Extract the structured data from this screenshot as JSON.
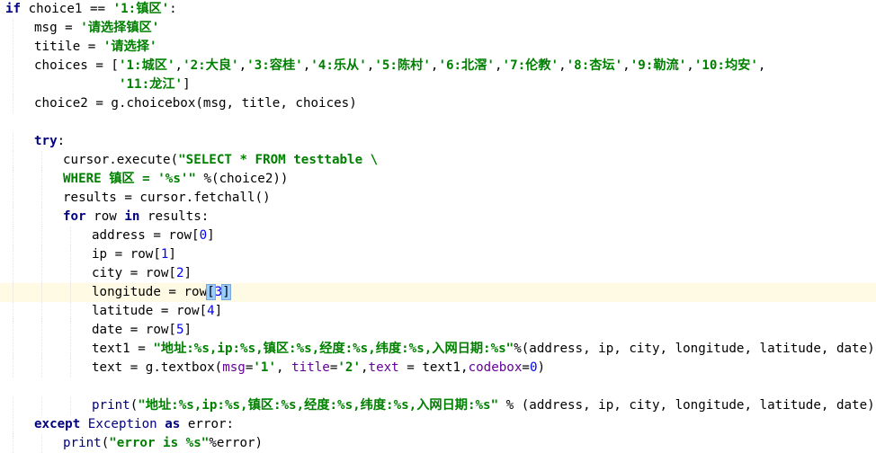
{
  "code_lines": [
    {
      "indent": 0,
      "tokens": [
        [
          "kw",
          "if"
        ],
        [
          "txt",
          " choice1 == "
        ],
        [
          "str",
          "'1:镇区'"
        ],
        [
          "txt",
          ":"
        ]
      ]
    },
    {
      "indent": 1,
      "tokens": [
        [
          "txt",
          "msg = "
        ],
        [
          "str",
          "'请选择镇区'"
        ]
      ]
    },
    {
      "indent": 1,
      "tokens": [
        [
          "txt",
          "titile = "
        ],
        [
          "str",
          "'请选择'"
        ]
      ]
    },
    {
      "indent": 1,
      "tokens": [
        [
          "txt",
          "choices = ["
        ],
        [
          "str",
          "'1:城区'"
        ],
        [
          "txt",
          ","
        ],
        [
          "str",
          "'2:大良'"
        ],
        [
          "txt",
          ","
        ],
        [
          "str",
          "'3:容桂'"
        ],
        [
          "txt",
          ","
        ],
        [
          "str",
          "'4:乐从'"
        ],
        [
          "txt",
          ","
        ],
        [
          "str",
          "'5:陈村'"
        ],
        [
          "txt",
          ","
        ],
        [
          "str",
          "'6:北滘'"
        ],
        [
          "txt",
          ","
        ],
        [
          "str",
          "'7:伦教'"
        ],
        [
          "txt",
          ","
        ],
        [
          "str",
          "'8:杏坛'"
        ],
        [
          "txt",
          ","
        ],
        [
          "str",
          "'9:勒流'"
        ],
        [
          "txt",
          ","
        ],
        [
          "str",
          "'10:均安'"
        ],
        [
          "txt",
          ","
        ]
      ]
    },
    {
      "indent": 1,
      "pad": "           ",
      "tokens": [
        [
          "str",
          "'11:龙江'"
        ],
        [
          "txt",
          "]"
        ]
      ]
    },
    {
      "indent": 1,
      "tokens": [
        [
          "txt",
          "choice2 = g.choicebox(msg, title, choices)"
        ]
      ]
    },
    {
      "indent": 0,
      "tokens": []
    },
    {
      "indent": 1,
      "tokens": [
        [
          "kw",
          "try"
        ],
        [
          "txt",
          ":"
        ]
      ]
    },
    {
      "indent": 2,
      "tokens": [
        [
          "txt",
          "cursor.execute("
        ],
        [
          "str",
          "\"SELECT * FROM testtable \\"
        ]
      ]
    },
    {
      "indent": 2,
      "tokens": [
        [
          "str",
          "WHERE 镇区 = '%s'\""
        ],
        [
          "txt",
          " %(choice2))"
        ]
      ]
    },
    {
      "indent": 2,
      "tokens": [
        [
          "txt",
          "results = cursor.fetchall()"
        ]
      ]
    },
    {
      "indent": 2,
      "tokens": [
        [
          "kw",
          "for"
        ],
        [
          "txt",
          " row "
        ],
        [
          "kw",
          "in"
        ],
        [
          "txt",
          " results:"
        ]
      ]
    },
    {
      "indent": 3,
      "tokens": [
        [
          "txt",
          "address = row["
        ],
        [
          "num",
          "0"
        ],
        [
          "txt",
          "]"
        ]
      ]
    },
    {
      "indent": 3,
      "tokens": [
        [
          "txt",
          "ip = row["
        ],
        [
          "num",
          "1"
        ],
        [
          "txt",
          "]"
        ]
      ]
    },
    {
      "indent": 3,
      "tokens": [
        [
          "txt",
          "city = row["
        ],
        [
          "num",
          "2"
        ],
        [
          "txt",
          "]"
        ]
      ]
    },
    {
      "indent": 3,
      "current": true,
      "tokens": [
        [
          "txt",
          "longitude = row"
        ],
        [
          "bracket",
          "["
        ],
        [
          "num",
          "3"
        ],
        [
          "bracket",
          "]"
        ],
        [
          "caret",
          ""
        ]
      ]
    },
    {
      "indent": 3,
      "tokens": [
        [
          "txt",
          "latitude = row["
        ],
        [
          "num",
          "4"
        ],
        [
          "txt",
          "]"
        ]
      ]
    },
    {
      "indent": 3,
      "tokens": [
        [
          "txt",
          "date = row["
        ],
        [
          "num",
          "5"
        ],
        [
          "txt",
          "]"
        ]
      ]
    },
    {
      "indent": 3,
      "tokens": [
        [
          "txt",
          "text1 = "
        ],
        [
          "str",
          "\"地址:%s,ip:%s,镇区:%s,经度:%s,纬度:%s,入网日期:%s\""
        ],
        [
          "txt",
          "%(address, ip, city, longitude, latitude, date)"
        ]
      ]
    },
    {
      "indent": 3,
      "tokens": [
        [
          "txt",
          "text = g.textbox("
        ],
        [
          "par",
          "msg"
        ],
        [
          "txt",
          "="
        ],
        [
          "str",
          "'1'"
        ],
        [
          "txt",
          ", "
        ],
        [
          "par",
          "title"
        ],
        [
          "txt",
          "="
        ],
        [
          "str",
          "'2'"
        ],
        [
          "txt",
          ","
        ],
        [
          "par",
          "text"
        ],
        [
          "txt",
          " = text1,"
        ],
        [
          "par",
          "codebox"
        ],
        [
          "txt",
          "="
        ],
        [
          "num",
          "0"
        ],
        [
          "txt",
          ")"
        ]
      ]
    },
    {
      "indent": 0,
      "tokens": []
    },
    {
      "indent": 3,
      "tokens": [
        [
          "bi",
          "print"
        ],
        [
          "txt",
          "("
        ],
        [
          "str",
          "\"地址:%s,ip:%s,镇区:%s,经度:%s,纬度:%s,入网日期:%s\""
        ],
        [
          "txt",
          " % (address, ip, city, longitude, latitude, date))"
        ]
      ]
    },
    {
      "indent": 1,
      "tokens": [
        [
          "kw",
          "except"
        ],
        [
          "bi",
          " Exception "
        ],
        [
          "kw",
          "as"
        ],
        [
          "txt",
          " error:"
        ]
      ]
    },
    {
      "indent": 2,
      "tokens": [
        [
          "bi",
          "print"
        ],
        [
          "txt",
          "("
        ],
        [
          "str",
          "\"error is %s\""
        ],
        [
          "txt",
          "%error)"
        ]
      ]
    }
  ]
}
